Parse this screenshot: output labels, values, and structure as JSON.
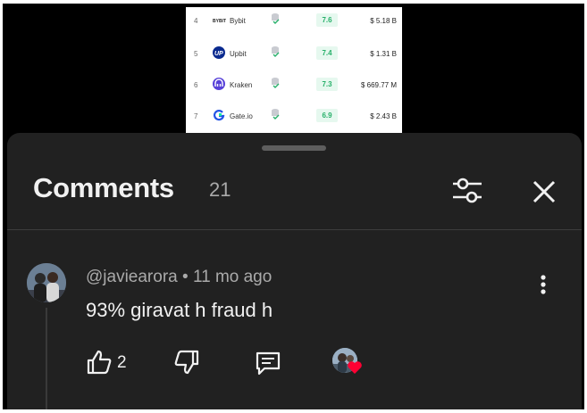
{
  "exchanges": [
    {
      "rank": "4",
      "name": "Bybit",
      "score": "7.6",
      "volume": "$ 5.18 B",
      "logo_text": "BYBIT",
      "logo_color": "#222222"
    },
    {
      "rank": "5",
      "name": "Upbit",
      "score": "7.4",
      "volume": "$ 1.31 B",
      "logo_text": "UP",
      "logo_color": "#0a2a8f"
    },
    {
      "rank": "6",
      "name": "Kraken",
      "score": "7.3",
      "volume": "$ 669.77 M",
      "logo_text": "m",
      "logo_color": "#5741d9"
    },
    {
      "rank": "7",
      "name": "Gate.io",
      "score": "6.9",
      "volume": "$ 2.43 B",
      "logo_text": "G",
      "logo_color": "#2354e6"
    }
  ],
  "comments_panel": {
    "title": "Comments",
    "count": "21",
    "filter_icon": "sliders-icon",
    "close_icon": "close-icon"
  },
  "comment": {
    "author": "@javiearora",
    "separator": "•",
    "time": "11 mo ago",
    "text": "93% giravat h fraud h",
    "like_count": "2"
  },
  "colors": {
    "sheet_bg": "#212121",
    "text_primary": "#f1f1f1",
    "text_secondary": "#aaaaaa",
    "score_green": "#27b06a",
    "heart_red": "#ff0033"
  }
}
